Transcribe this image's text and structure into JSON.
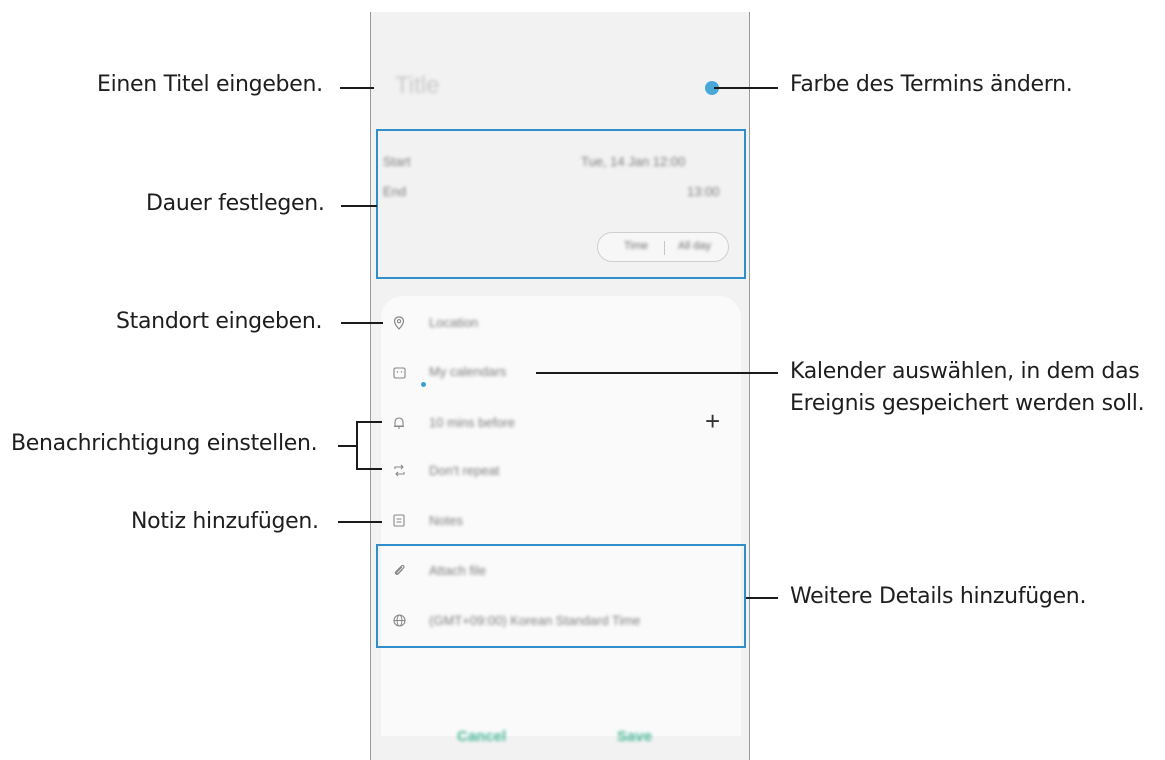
{
  "callouts": {
    "title": "Einen Titel eingeben.",
    "color": "Farbe des Termins ändern.",
    "duration": "Dauer festlegen.",
    "location": "Standort eingeben.",
    "calendar_line1": "Kalender auswählen, in dem das",
    "calendar_line2": "Ereignis gespeichert werden soll.",
    "notification": "Benachrichtigung einstellen.",
    "note": "Notiz hinzufügen.",
    "details": "Weitere Details hinzufügen."
  },
  "phone": {
    "title_placeholder": "Title",
    "start_label": "Start",
    "start_value": "Tue, 14 Jan  12:00",
    "end_label": "End",
    "end_value": "13:00",
    "toggle_time": "Time",
    "toggle_allday": "All day",
    "location": "Location",
    "calendar": "My calendars",
    "reminder": "10 mins before",
    "repeat": "Don't repeat",
    "notes": "Notes",
    "attach": "Attach file",
    "timezone": "(GMT+09:00) Korean Standard Time",
    "cancel": "Cancel",
    "save": "Save"
  },
  "icons": {
    "location": "map-pin-icon",
    "calendar": "calendar-icon",
    "reminder": "bell-icon",
    "repeat": "repeat-icon",
    "notes": "notes-icon",
    "attach": "paperclip-icon",
    "timezone": "globe-icon",
    "add": "plus-icon"
  },
  "colors": {
    "highlight": "#2f8fcb",
    "event_color": "#4aa8d8",
    "action": "#4bb89a"
  }
}
